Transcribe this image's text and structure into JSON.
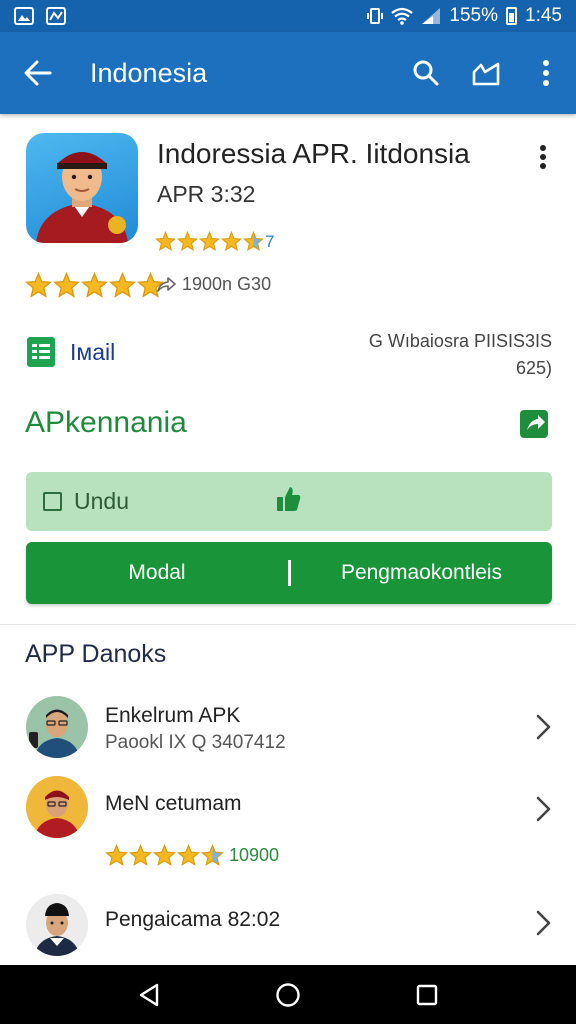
{
  "status_bar": {
    "battery_text": "155%",
    "time": "1:45"
  },
  "app_bar": {
    "title": "Indonesia",
    "back_icon": "arrow-left-icon",
    "search_icon": "search-icon",
    "share_icon": "share-icon",
    "more_icon": "more-vert-icon"
  },
  "app": {
    "name": "Indoressia APR. Iitdonsia",
    "version": "APR 3:32",
    "small_rating": {
      "stars": 4.5,
      "value": "7"
    },
    "big_rating": {
      "stars": 5
    },
    "downloads": "1900n G30"
  },
  "mail": {
    "label": "Iмail"
  },
  "developer": {
    "line1": "G Wıbaiosra PIISIS3IS",
    "line2": "625)"
  },
  "section": {
    "title": "APkennania"
  },
  "undu": {
    "label": "Undu"
  },
  "actions": {
    "left": "Modal",
    "right": "Pengmaokontleis"
  },
  "list": {
    "title": "APP Danoks",
    "items": [
      {
        "title": "Enkelrum APK",
        "subtitle": "Paookl IX Q 3407412"
      },
      {
        "title": "MeN cetumam",
        "rating": 4.5,
        "rating_text": "10900"
      },
      {
        "title": "Pengaicama 82:02"
      }
    ]
  },
  "colors": {
    "status_bar": "#1663ad",
    "app_bar": "#1d70bd",
    "green_primary": "#199439",
    "green_light": "#b8e2bd",
    "star": "#f5b820"
  }
}
